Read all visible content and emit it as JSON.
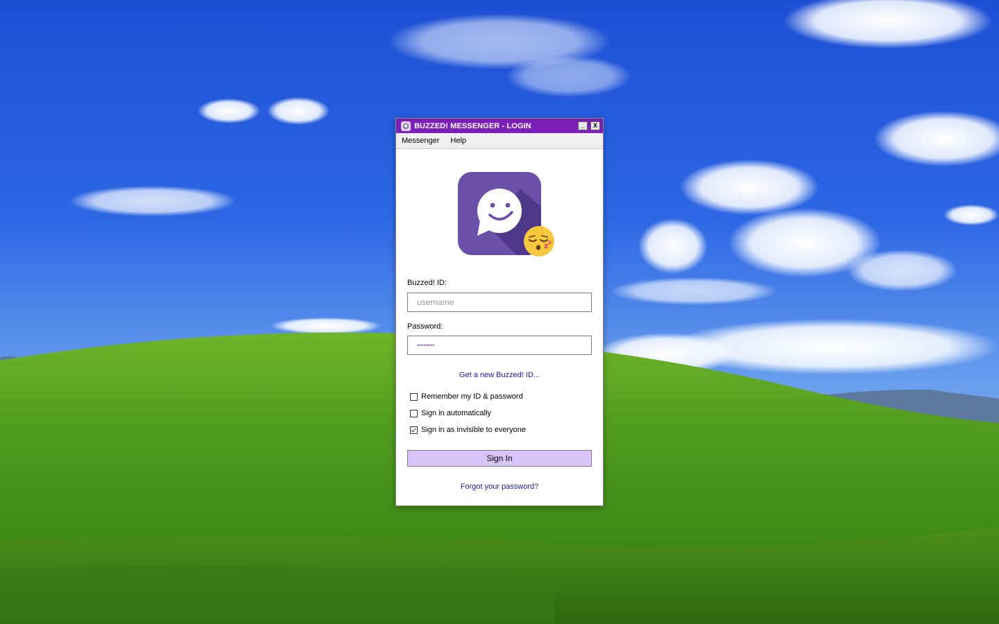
{
  "window": {
    "title": "BUZZED! MESSENGER - LOGIN",
    "minimize_label": "_",
    "close_label": "X"
  },
  "menu": {
    "items": [
      {
        "label": "Messenger"
      },
      {
        "label": "Help"
      }
    ]
  },
  "login": {
    "id_label": "Buzzed! ID:",
    "username_placeholder": "username",
    "username_value": "",
    "password_label": "Password:",
    "password_value": "••••••••",
    "new_id_link": "Get a new Buzzed! ID...",
    "options": [
      {
        "label": "Remember my ID & password",
        "checked": false
      },
      {
        "label": "Sign in automatically",
        "checked": false
      },
      {
        "label": "Sign in as invisible to everyone",
        "checked": true
      }
    ],
    "sign_in_label": "Sign In",
    "forgot_link": "Forgot your password?"
  },
  "icons": {
    "app_logo": "smiling-chat-bubble-icon",
    "status_badge": "sleeping-face-icon"
  },
  "colors": {
    "titlebar": "#7c1fb8",
    "logo_bg": "#6b4fa8",
    "sign_in_button": "#d9c4fa",
    "link": "#1a1aa6"
  }
}
